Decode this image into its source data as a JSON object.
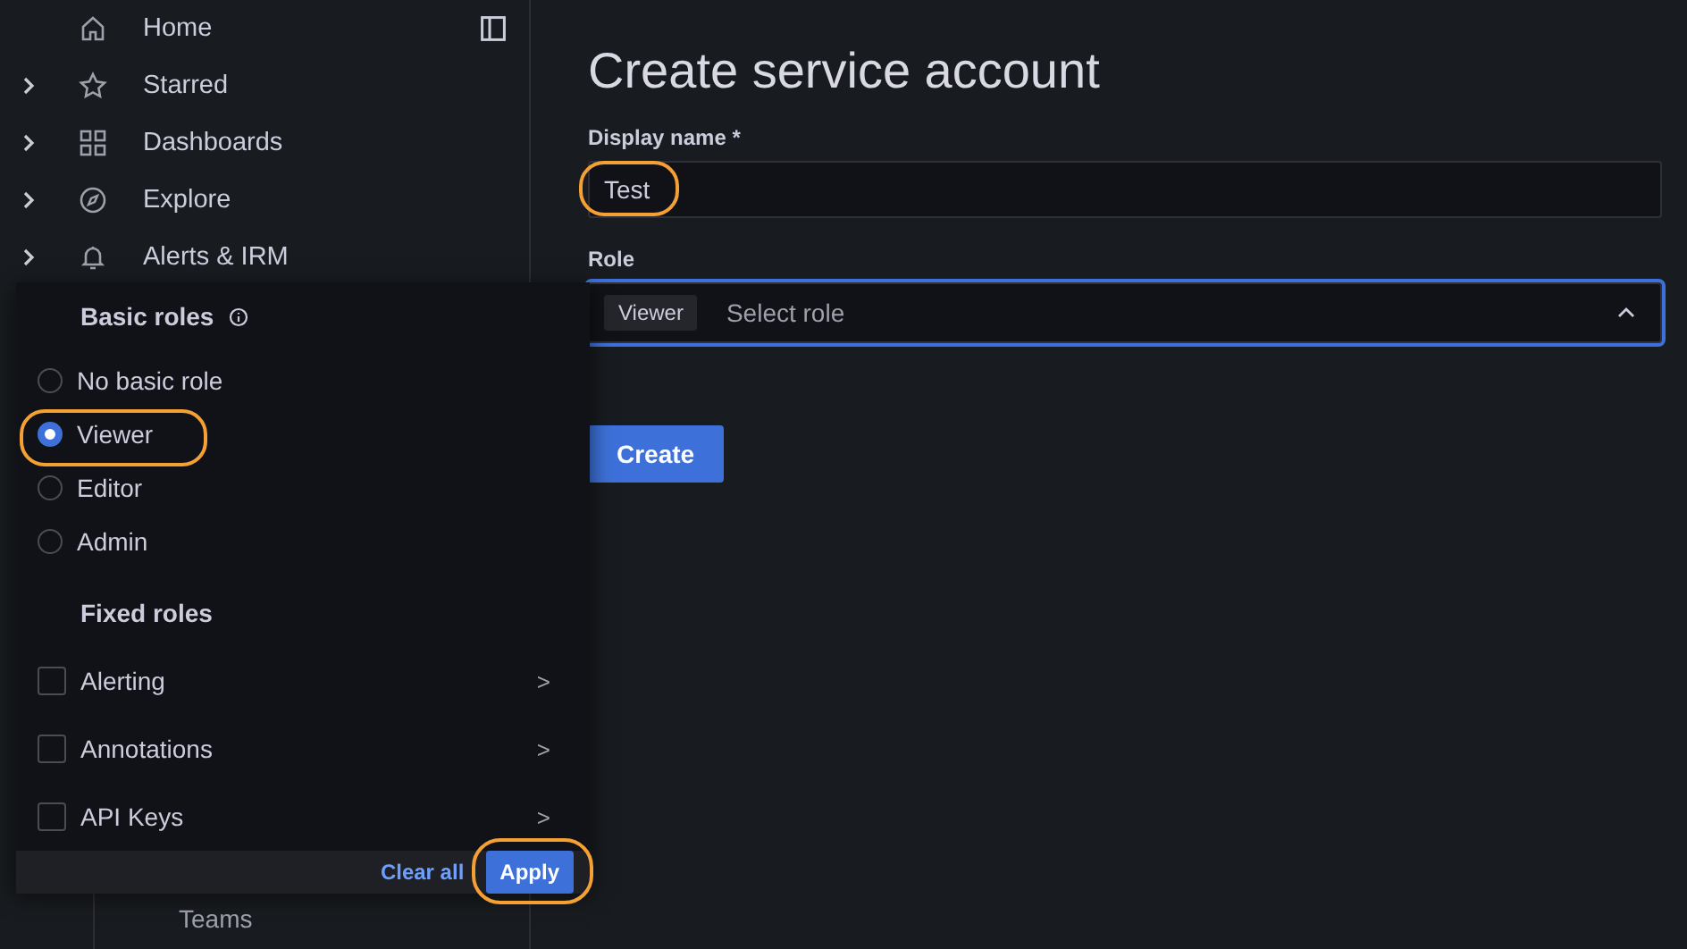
{
  "sidebar": {
    "items": [
      {
        "label": "Home",
        "expandable": false
      },
      {
        "label": "Starred",
        "expandable": true
      },
      {
        "label": "Dashboards",
        "expandable": true
      },
      {
        "label": "Explore",
        "expandable": true
      },
      {
        "label": "Alerts & IRM",
        "expandable": true
      }
    ],
    "sub_items": [
      "Teams"
    ]
  },
  "page": {
    "title": "Create service account",
    "display_name": {
      "label": "Display name *",
      "value": "Test"
    },
    "role": {
      "label": "Role",
      "tag": "Viewer",
      "placeholder": "Select role"
    },
    "create_button": "Create"
  },
  "role_picker": {
    "basic_title": "Basic roles",
    "basic_roles": [
      {
        "label": "No basic role",
        "selected": false
      },
      {
        "label": "Viewer",
        "selected": true
      },
      {
        "label": "Editor",
        "selected": false
      },
      {
        "label": "Admin",
        "selected": false
      }
    ],
    "fixed_title": "Fixed roles",
    "fixed_roles": [
      {
        "label": "Alerting",
        "checked": false,
        "arrow": ">"
      },
      {
        "label": "Annotations",
        "checked": false,
        "arrow": ">"
      },
      {
        "label": "API Keys",
        "checked": false,
        "arrow": ">"
      }
    ],
    "clear_button": "Clear all",
    "apply_button": "Apply"
  }
}
